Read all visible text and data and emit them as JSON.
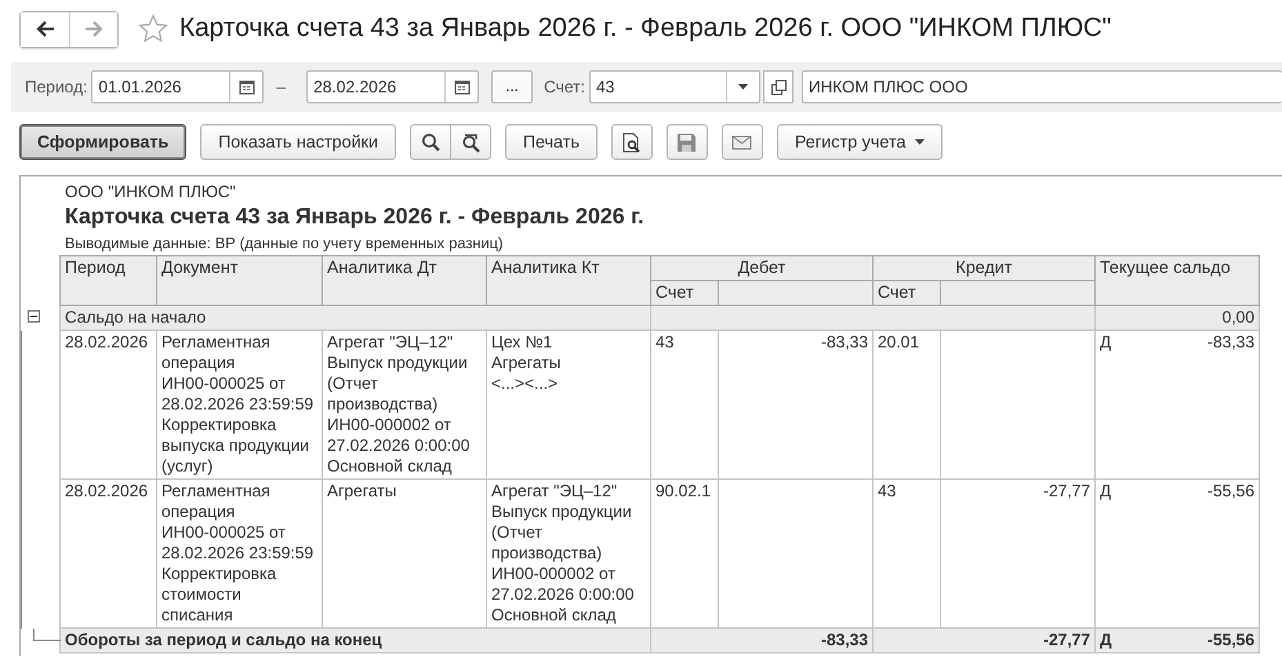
{
  "window": {
    "title": "Карточка счета 43 за Январь 2026 г. - Февраль 2026 г. ООО \"ИНКОМ ПЛЮС\"",
    "favorite": false
  },
  "filters": {
    "period_label": "Период:",
    "date_from": "01.01.2026",
    "dash": "–",
    "date_to": "28.02.2026",
    "more_button": "...",
    "account_label": "Счет:",
    "account": "43",
    "organization": "ИНКОМ ПЛЮС ООО"
  },
  "toolbar": [
    {
      "kind": "text",
      "label": "Сформировать",
      "default": true
    },
    {
      "kind": "text",
      "label": "Показать настройки",
      "default": false
    },
    {
      "kind": "group",
      "items": [
        {
          "kind": "search"
        },
        {
          "kind": "search-refresh"
        }
      ]
    },
    {
      "kind": "text",
      "label": "Печать",
      "default": false
    },
    {
      "kind": "preview"
    },
    {
      "kind": "save"
    },
    {
      "kind": "mail"
    },
    {
      "kind": "menu",
      "label": "Регистр учета"
    }
  ],
  "report": {
    "organization": "ООО \"ИНКОМ ПЛЮС\"",
    "title": "Карточка счета 43 за Январь 2026 г. - Февраль 2026 г.",
    "note": "Выводимые данные: ВР (данные по учету временных разниц)",
    "columns": {
      "period": "Период",
      "document": "Документ",
      "analytics_dt": "Аналитика Дт",
      "analytics_kt": "Аналитика Кт",
      "debit": "Дебет",
      "debit_account": "Счет",
      "credit": "Кредит",
      "credit_account": "Счет",
      "balance": "Текущее сальдо"
    },
    "rows": [
      {
        "kind": "group",
        "expanded": true,
        "label": "Сальдо на начало",
        "balance_amount": "0,00"
      },
      {
        "kind": "entry",
        "period": "28.02.2026",
        "document": "Регламентная\nоперация\nИН00-000025 от\n28.02.2026 23:59:59\nКорректировка\nвыпуска продукции\n(услуг)",
        "analytics_dt": "Агрегат \"ЭЦ–12\"\nВыпуск продукции\n(Отчет\nпроизводства)\nИН00-000002 от\n27.02.2026 0:00:00\nОсновной склад",
        "analytics_kt": "Цех №1\nАгрегаты\n<...><...>",
        "debit_account": "43",
        "debit_amount": "-83,33",
        "credit_account": "20.01",
        "credit_amount": "",
        "balance_side": "Д",
        "balance_amount": "-83,33"
      },
      {
        "kind": "entry",
        "period": "28.02.2026",
        "document": "Регламентная\nоперация\nИН00-000025 от\n28.02.2026 23:59:59\nКорректировка\nстоимости\nсписания",
        "analytics_dt": "Агрегаты",
        "analytics_kt": "Агрегат \"ЭЦ–12\"\nВыпуск продукции\n(Отчет\nпроизводства)\nИН00-000002 от\n27.02.2026 0:00:00\nОсновной склад",
        "debit_account": "90.02.1",
        "debit_amount": "",
        "credit_account": "43",
        "credit_amount": "-27,77",
        "balance_side": "Д",
        "balance_amount": "-55,56"
      },
      {
        "kind": "total",
        "label": "Обороты за период и сальдо на конец",
        "debit_amount": "-83,33",
        "credit_amount": "-27,77",
        "balance_side": "Д",
        "balance_amount": "-55,56"
      }
    ]
  }
}
